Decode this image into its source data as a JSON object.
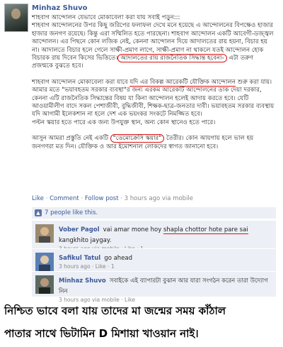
{
  "post": {
    "author": "Minhaz Shuvo",
    "paragraphs": [
      {
        "before": "শাহবাগ আন্দোলন যেভাবে মোকাবেলা করা যায় সবাই পড়ুন:::\nশাহবাগ আন্দোলনের উপর কিছু জরিপের ফলাফল দেখে মনে হয়েছে এ আন্দোলনের বিপক্ষেও হাজার হাজার জনগণ রয়েছে। কিন্তু এরা সম্মিলিত হতে পারছেনা। শাহবাগ আন্দোলন একটি আবেগী-ডজ্জ্বল আন্দোলন। এর পিছনে কোন লজিক নেই, কেননা আন্দোলন দিয়ে আদালতের রায় হয়না, বিচার হয় না। আদালতে বিচার হলে গেলে সাক্ষী-প্রমাণ লাগে, সাক্ষী-প্রমাণ না থাকলে যতই আন্দোলন হোক বিচারক রায় দিবেন কিসের ভিত্তিতে।",
        "marked": "আদালতের রায় রাজনৈতিক সিদ্ধান্ত হবেনা-",
        "after": " এটা তরুণ প্রজন্মকে বুঝতে হবে।"
      },
      {
        "before": "শাহবাগ আন্দোলন মোকাবেলা করা যাবে ",
        "marked": "যদি এর বিকল্প আরেকটি যৌক্তিক আন্দোলন",
        "after": " শুরু করা যায়। আমার মতে \"ভয়াবহতম সরকার ব্যবস্থা\"র জন্য এরকম আরেকটি আন্দোলনের ডাক দেয়া দরকার, কেননা এটি রাজনৈতিক সিদ্ধান্তের বিষয় যা কিনা আন্দোলন হলেই আদায় করতে হবে। যেটি আওয়ামীলীগ বাদে সকল পেশাজীবী, বুদ্ধিজীবী, শিক্ষক-ছাত্র-জনতার দাবী। ভয়াবহতম সরকার ব্যবস্থায় যদি আগামী ইলেকশান না হলে দেশ এক ভয়ংকর সংকটে নিমজ্জিত হবে।\nপল্টন স্কয়ার হতে পারে এক জন্য উপযুক্ত স্থান, অন্য কোন স্থানেও হতে পারে।"
      },
      {
        "before": "আসুন আমরা প্রস্তুতি নেই একটি ",
        "marked": "\"ডেমোক্রেসি স্কয়ার\"",
        "after": " তৈরীর। কোন আয়গায় হলে ভাল হয় জনগণরা মত দিন। যৌক্তিক ও আর ইমোশনাল লোকদের স্বাগত জানানো হবে।"
      }
    ],
    "actions": {
      "like": "Like",
      "comment": "Comment",
      "follow": "Follow post",
      "time": "3 hours ago via mobile"
    },
    "likes_text": "7 people like this."
  },
  "comments": [
    {
      "name": "Vober Pagol",
      "text_before": "vai amar mone hoy ",
      "text_marked": "shapla chottor hote pare sai",
      "text_after": " kangkhito jaygay.",
      "meta": "3 hours ago via mobile · Like · 1"
    },
    {
      "name": "Safikul Tatul",
      "text_before": "go ahead",
      "text_marked": "",
      "text_after": "",
      "meta": "3 hours ago · Like · 1"
    },
    {
      "name": "Minhaz Shuvo",
      "text_before": "সবাইকে এই ব্যাপারটা বুঝান আর যারা সংগঠন করেন তারা উদ্যোগ নিন",
      "text_marked": "",
      "text_after": "",
      "meta": "3 hours ago via mobile · Like"
    }
  ],
  "caption": {
    "line1": "নিশ্চিত ভাবে বলা যায় তাদের মা জন্মের সময় কাঁঠাল",
    "line2": "পাতার সাথে ভিটামিন D  মিশায়া খাওয়ান নাই।"
  }
}
